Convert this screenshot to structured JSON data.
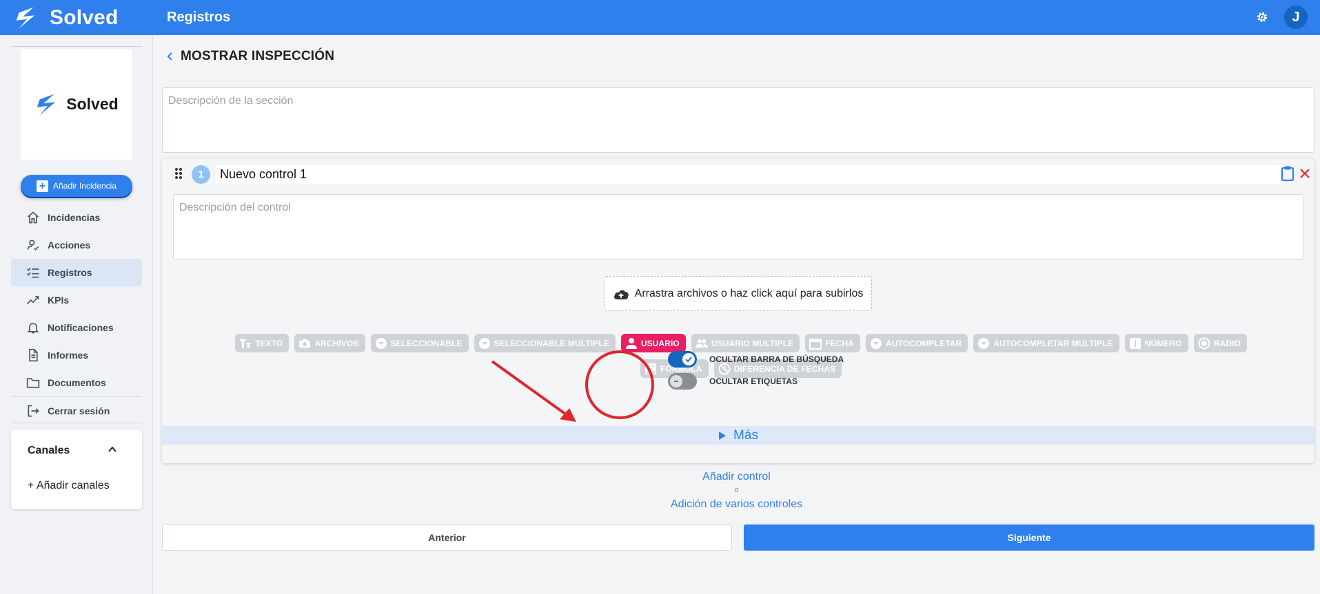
{
  "app": {
    "brand": "Solved",
    "page_title": "Registros",
    "avatar_initial": "J"
  },
  "sidebar": {
    "logo_text": "Solved",
    "add_incidencia_label": "Añadir Incidencia",
    "items": [
      {
        "label": "Incidencias",
        "icon": "home-icon"
      },
      {
        "label": "Acciones",
        "icon": "user-check-icon"
      },
      {
        "label": "Registros",
        "icon": "checklist-icon",
        "active": true
      },
      {
        "label": "KPIs",
        "icon": "trend-icon"
      },
      {
        "label": "Notificaciones",
        "icon": "bell-icon"
      },
      {
        "label": "Informes",
        "icon": "document-icon"
      },
      {
        "label": "Documentos",
        "icon": "folder-icon"
      },
      {
        "label": "Cerrar sesión",
        "icon": "logout-icon"
      }
    ],
    "channels": {
      "title": "Canales",
      "add_label": "+ Añadir canales"
    }
  },
  "main": {
    "title": "MOSTRAR INSPECCIÓN",
    "section_description_placeholder": "Descripción de la sección",
    "control": {
      "number": "1",
      "title": "Nuevo control 1",
      "description_placeholder": "Descripción del control",
      "dropzone_text": "Arrastra archivos o haz click aquí para subirlos",
      "types": [
        {
          "label": "TEXTO",
          "icon": "text-icon"
        },
        {
          "label": "ARCHIVOS",
          "icon": "camera-icon"
        },
        {
          "label": "SELECCIONABLE",
          "icon": "dropdown-icon"
        },
        {
          "label": "SELECCIONABLE MULTIPLE",
          "icon": "dropdown-icon"
        },
        {
          "label": "USUARIO",
          "icon": "user-icon",
          "selected": true
        },
        {
          "label": "USUARIO MULTIPLE",
          "icon": "users-icon"
        },
        {
          "label": "FECHA",
          "icon": "calendar-icon"
        },
        {
          "label": "AUTOCOMPLETAR",
          "icon": "dropdown-icon"
        },
        {
          "label": "AUTOCOMPLETAR MULTIPLE",
          "icon": "dropdown-icon"
        },
        {
          "label": "NÚMERO",
          "icon": "number-icon"
        },
        {
          "label": "RADIO",
          "icon": "radio-icon"
        },
        {
          "label": "FÓRMULA",
          "icon": "formula-icon"
        },
        {
          "label": "DIFERENCIA DE FECHAS",
          "icon": "date-diff-icon"
        }
      ],
      "toggles": [
        {
          "label": "OCULTAR BARRA DE BÚSQUEDA",
          "on": true
        },
        {
          "label": "OCULTAR ETIQUETAS",
          "on": false
        }
      ],
      "more_label": "Más"
    },
    "add_control_label": "Añadir control",
    "or_label": "o",
    "add_multiple_label": "Adición de varios controles",
    "prev_label": "Anterior",
    "next_label": "Siguiente"
  },
  "colors": {
    "primary": "#2f80ed",
    "selected_chip": "#e91e63",
    "chip_disabled": "#cfd2d6",
    "annotation": "#e0262c"
  }
}
